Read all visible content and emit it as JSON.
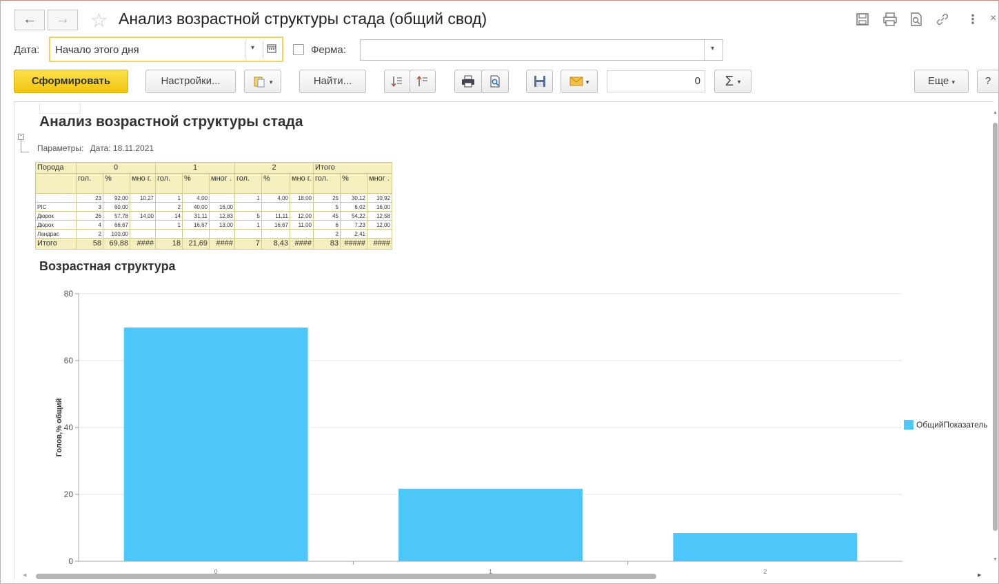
{
  "window": {
    "title": "Анализ возрастной структуры стада (общий свод)"
  },
  "form": {
    "date_label": "Дата:",
    "date_value": "Начало этого дня",
    "farm_label": "Ферма:",
    "farm_value": ""
  },
  "toolbar": {
    "generate_label": "Сформировать",
    "settings_label": "Настройки...",
    "find_label": "Найти...",
    "number_value": "0",
    "sum_label": "Σ",
    "more_label": "Еще",
    "help_label": "?"
  },
  "report": {
    "title": "Анализ возрастной структуры стада",
    "params_label": "Параметры:",
    "params_value": "Дата: 18.11.2021",
    "table": {
      "group_headers": [
        "Порода",
        "0",
        "1",
        "2",
        "Итого"
      ],
      "sub_headers": [
        "гол.",
        "%",
        "мно г.",
        "гол.",
        "%",
        "мног .",
        "гол.",
        "%",
        "мно г.",
        "гол.",
        "%",
        "мног ."
      ],
      "rows": [
        [
          "",
          "23",
          "92,00",
          "10,27",
          "1",
          "4,00",
          "",
          "1",
          "4,00",
          "18,00",
          "25",
          "30,12",
          "10,92"
        ],
        [
          "PIC",
          "3",
          "60,00",
          "",
          "2",
          "40,00",
          "16,00",
          "",
          "",
          "",
          "5",
          "6,02",
          "16,00"
        ],
        [
          "Дюрок",
          "26",
          "57,78",
          "14,00",
          "14",
          "31,11",
          "12,83",
          "5",
          "11,11",
          "12,00",
          "45",
          "54,22",
          "12,58"
        ],
        [
          "Дюрок",
          "4",
          "66,67",
          "",
          "1",
          "16,67",
          "13,00",
          "1",
          "16,67",
          "11,00",
          "6",
          "7,23",
          "12,00"
        ],
        [
          "Ландрас",
          "2",
          "100,00",
          "",
          "",
          "",
          "",
          "",
          "",
          "",
          "2",
          "2,41",
          ""
        ]
      ],
      "total_row": [
        "Итого",
        "58",
        "69,88",
        "####",
        "18",
        "21,69",
        "####",
        "7",
        "8,43",
        "####",
        "83",
        "#####",
        "####"
      ]
    },
    "chart_title": "Возрастная структура"
  },
  "chart_data": {
    "type": "bar",
    "title": "Возрастная структура",
    "categories": [
      "0",
      "1",
      "2"
    ],
    "series": [
      {
        "name": "ОбщийПоказатель",
        "values": [
          69.88,
          21.69,
          8.43
        ],
        "color": "#4dc6f9"
      }
    ],
    "ylabel": "Голов,% общий",
    "xlabel": "",
    "ylim": [
      0,
      80
    ],
    "yticks": [
      0,
      20,
      40,
      60,
      80
    ],
    "grid": true,
    "legend": "right"
  }
}
